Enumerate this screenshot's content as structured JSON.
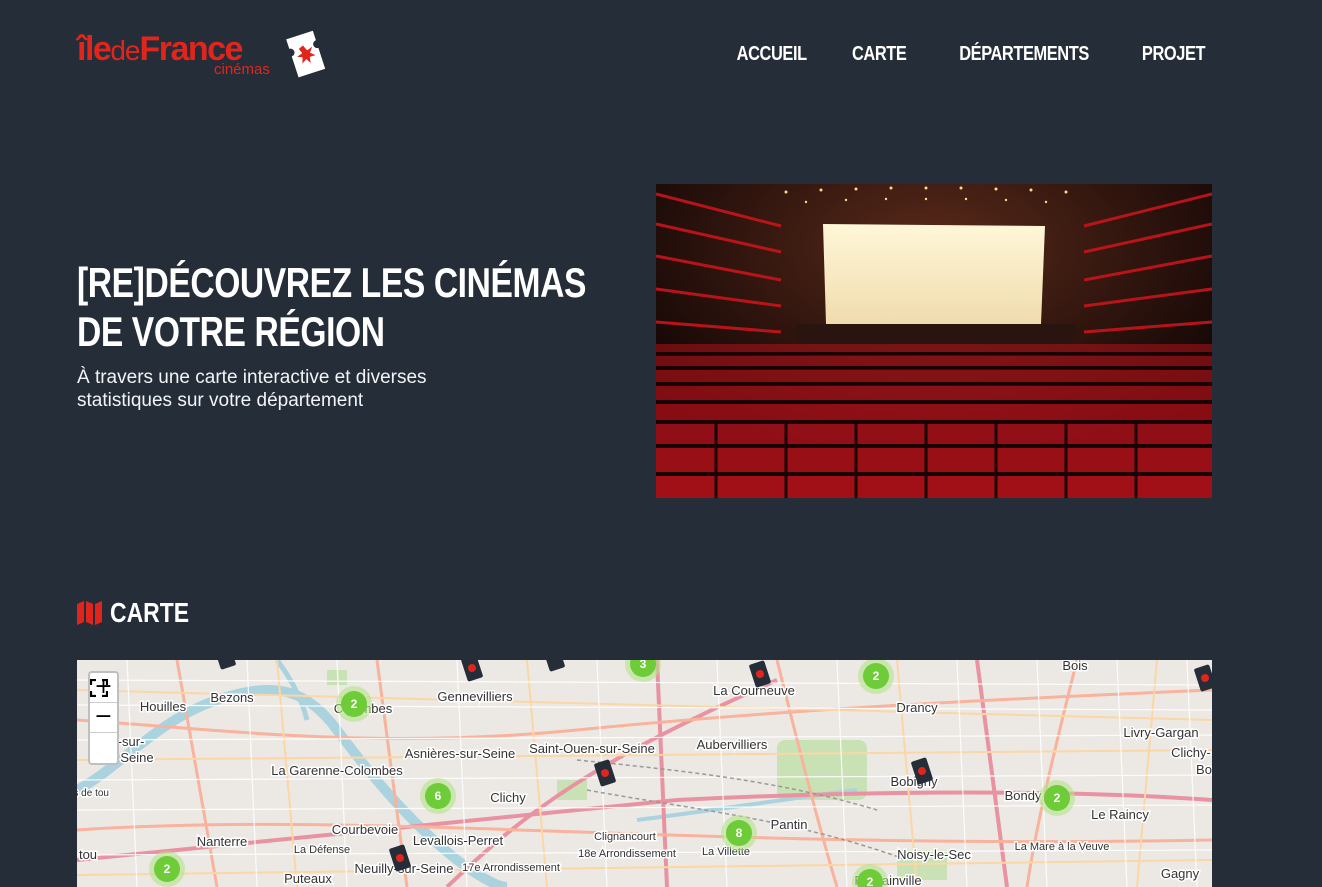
{
  "brand": {
    "logo_main_1": "île",
    "logo_main_2": "de",
    "logo_main_3": "France",
    "logo_sub": "cinémas",
    "accent_color": "#e0261c",
    "background_color": "#252d38"
  },
  "nav": {
    "items": [
      "ACCUEIL",
      "CARTE",
      "DÉPARTEMENTS",
      "PROJET"
    ]
  },
  "hero": {
    "title": "[RE]DÉCOUVREZ LES CINÉMAS DE VOTRE RÉGION",
    "subtitle": "À travers une carte interactive et diverses statistiques sur votre département",
    "image_icon": "cinema-theater-photo"
  },
  "map_section": {
    "title": "CARTE",
    "icon": "map-icon",
    "controls": {
      "zoom_in": "+",
      "zoom_out": "−",
      "fullscreen_icon": "fullscreen-icon"
    },
    "place_labels": [
      "Bois",
      "La Courneuve",
      "Drancy",
      "Bezons",
      "Houilles",
      "Gennevilliers",
      "Colombes",
      "Aubervilliers",
      "Livry-Gargan",
      "Clichy-",
      "Bo",
      "Asnières-sur-Seine",
      "Saint-Ouen-sur-Seine",
      "Bobigny",
      "Seine",
      "La Garenne-Colombes",
      "Clichy",
      "Bondy",
      "Le Raincy",
      "uts de tou",
      "Courbevoie",
      "Levallois-Perret",
      "Pantin",
      "Clignancourt",
      "18e Arrondissement",
      "Nanterre",
      "La Défense",
      "La Villette",
      "Noisy-le-Sec",
      "La Mare à la Veuve",
      "tou",
      "Puteaux",
      "Neuilly-sur-Seine",
      "17e Arrondissement",
      "Romainville",
      "Gagny",
      "ières-sur-"
    ],
    "clusters": [
      "3",
      "2",
      "2",
      "6",
      "8",
      "2",
      "2",
      "2"
    ]
  }
}
